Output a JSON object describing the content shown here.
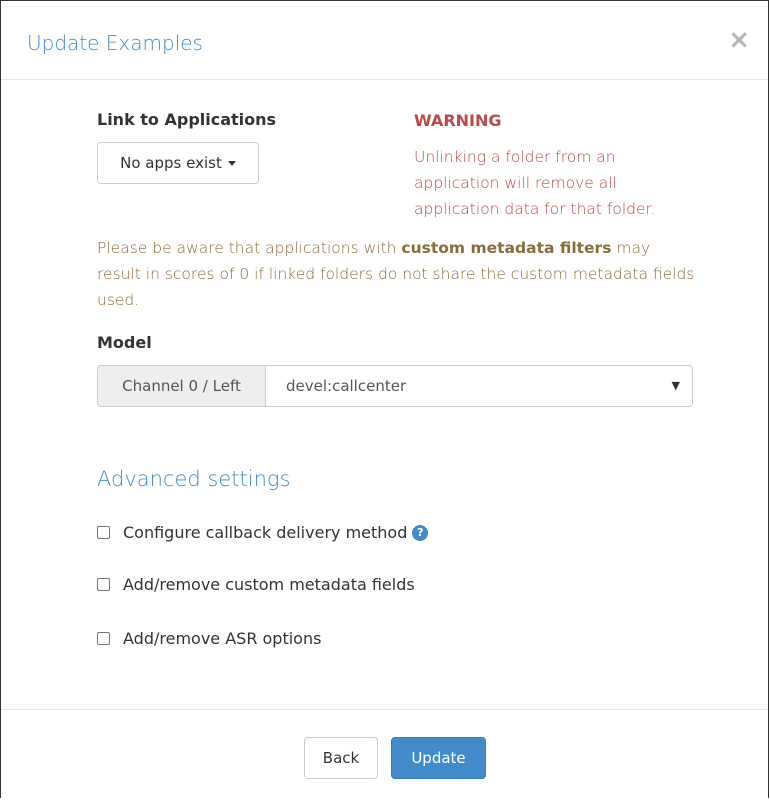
{
  "modal": {
    "title": "Update Examples",
    "close_glyph": "×"
  },
  "link_apps": {
    "label": "Link to Applications",
    "dropdown_value": "No apps exist"
  },
  "warning": {
    "title": "WARNING",
    "text": "Unlinking a folder from an application will remove all application data for that folder."
  },
  "notice": {
    "prefix": "Please be aware that applications with ",
    "emphasis": "custom metadata filters",
    "suffix": " may result in scores of 0 if linked folders do not share the custom metadata fields used."
  },
  "model": {
    "label": "Model",
    "channel_addon": "Channel 0 / Left",
    "selected": "devel:callcenter"
  },
  "advanced": {
    "title": "Advanced settings",
    "options": [
      {
        "label": "Configure callback delivery method",
        "checked": false,
        "help_icon": "question-circle-icon"
      },
      {
        "label": "Add/remove custom metadata fields",
        "checked": false
      },
      {
        "label": "Add/remove ASR options",
        "checked": false
      }
    ]
  },
  "footer": {
    "back_label": "Back",
    "update_label": "Update"
  },
  "colors": {
    "primary": "#428bca",
    "danger": "#b94a48",
    "warning_text": "#8a6d3b"
  }
}
